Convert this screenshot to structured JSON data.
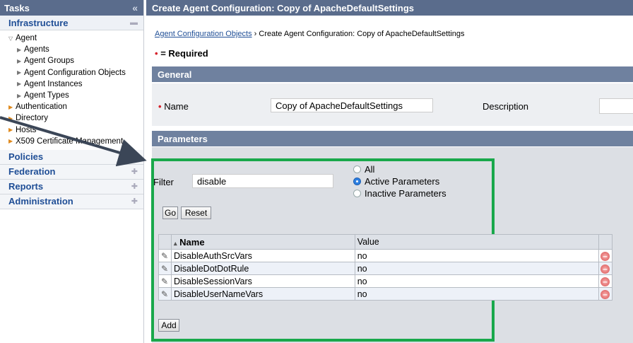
{
  "sidebar": {
    "tasks_title": "Tasks",
    "collapse_glyph": "«",
    "infrastructure": {
      "label": "Infrastructure",
      "icon": "minus-icon"
    },
    "tree": [
      {
        "label": "Agent",
        "level": 1,
        "icon": "expanded-arrow-icon"
      },
      {
        "label": "Agents",
        "level": 2,
        "icon": "collapsed-arrow-icon"
      },
      {
        "label": "Agent Groups",
        "level": 2,
        "icon": "collapsed-arrow-icon"
      },
      {
        "label": "Agent Configuration Objects",
        "level": 2,
        "icon": "collapsed-arrow-icon"
      },
      {
        "label": "Agent Instances",
        "level": 2,
        "icon": "collapsed-arrow-icon"
      },
      {
        "label": "Agent Types",
        "level": 2,
        "icon": "collapsed-arrow-icon"
      },
      {
        "label": "Authentication",
        "level": 1,
        "icon": "orange-arrow-icon"
      },
      {
        "label": "Directory",
        "level": 1,
        "icon": "orange-arrow-icon"
      },
      {
        "label": "Hosts",
        "level": 1,
        "icon": "orange-arrow-icon"
      },
      {
        "label": "X509 Certificate Management",
        "level": 1,
        "icon": "orange-arrow-icon"
      }
    ],
    "sections": [
      {
        "label": "Policies",
        "icon": "plus-icon"
      },
      {
        "label": "Federation",
        "icon": "plus-icon"
      },
      {
        "label": "Reports",
        "icon": "plus-icon"
      },
      {
        "label": "Administration",
        "icon": "plus-icon"
      }
    ]
  },
  "main": {
    "title": "Create Agent Configuration: Copy of ApacheDefaultSettings",
    "breadcrumb": {
      "link": "Agent Configuration Objects",
      "separator": "›",
      "current": "Create Agent Configuration: Copy of ApacheDefaultSettings"
    },
    "required": {
      "marker": "•",
      "text": "= Required"
    },
    "general": {
      "title": "General",
      "name_label": "Name",
      "name_value": "Copy of ApacheDefaultSettings",
      "description_label": "Description"
    },
    "parameters": {
      "title": "Parameters",
      "filter_label": "Filter",
      "filter_value": "disable",
      "radios": [
        {
          "label": "All",
          "selected": false
        },
        {
          "label": "Active Parameters",
          "selected": true
        },
        {
          "label": "Inactive Parameters",
          "selected": false
        }
      ],
      "go_label": "Go",
      "reset_label": "Reset",
      "columns": {
        "name": "Name",
        "value": "Value",
        "sort_glyph": "▴"
      },
      "rows": [
        {
          "name": "DisableAuthSrcVars",
          "value": "no"
        },
        {
          "name": "DisableDotDotRule",
          "value": "no"
        },
        {
          "name": "DisableSessionVars",
          "value": "no"
        },
        {
          "name": "DisableUserNameVars",
          "value": "no"
        }
      ],
      "add_label": "Add"
    }
  },
  "colors": {
    "header": "#5a6c8c",
    "highlight": "#19a84b",
    "required": "#d6212a"
  }
}
